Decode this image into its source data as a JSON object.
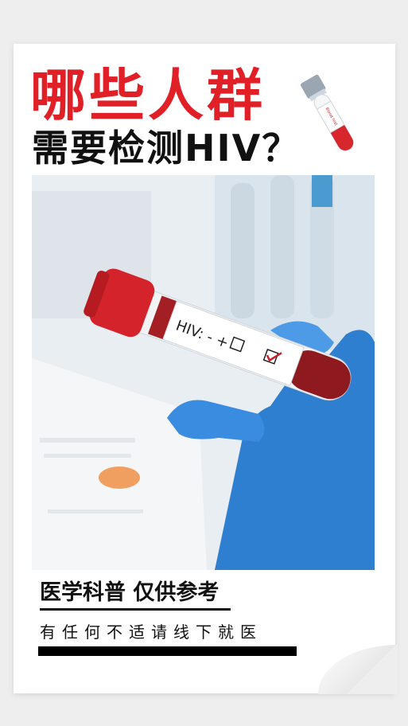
{
  "poster": {
    "title_line1": "哪些人群",
    "title_line2": "需要检测HIV？",
    "subtitle": "医学科普 仅供参考",
    "caption": "有任何不适请线下就医",
    "tube_icon_label": "Blood test",
    "photo_tube_label": "HIV: -  +",
    "accent_color": "#e01f26"
  },
  "icons": {
    "tube_icon": "blood-test-tube-icon"
  }
}
